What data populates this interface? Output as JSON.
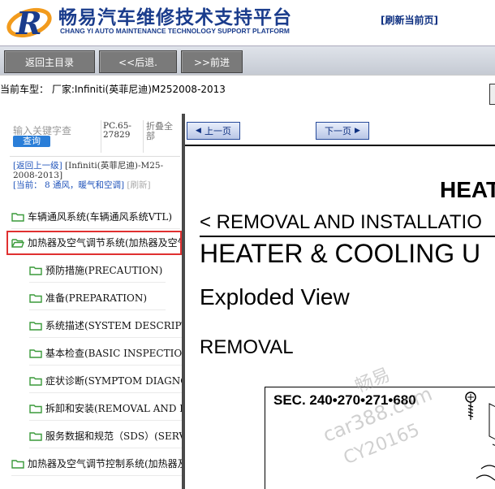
{
  "header": {
    "title": "畅易汽车维修技术支持平台",
    "subtitle": "CHANG YI AUTO MAINTENANCE TECHNOLOGY SUPPORT PLATFORM",
    "logo_icon": "chang-yi-r-logo"
  },
  "nav": {
    "main_menu": "返回主目录",
    "back": "<<后退.",
    "forward": ">>前进"
  },
  "model": {
    "text": "当前车型： 厂家:Infiniti(英菲尼迪)M252008-2013"
  },
  "sidebar": {
    "search_hint": "输入关键字查",
    "search_button": "查询",
    "pc_code": "PC.65-27829",
    "collapse_all": "折叠全部",
    "up_level": "[返回上一级]",
    "vehicle_path": "[Infiniti(英菲尼迪)-M25-2008-2013]",
    "current": "[当前：",
    "current_section": "8 通风，暖气和空调]",
    "refresh": "[刷新]",
    "items": [
      {
        "label": "车辆通风系统(车辆通风系统VTL)"
      },
      {
        "label": "加热器及空气调节系统(加热器及空气调节系统)"
      },
      {
        "label": "预防措施(PRECAUTION)"
      },
      {
        "label": "准备(PREPARATION)"
      },
      {
        "label": "系统描述(SYSTEM DESCRIPTION)"
      },
      {
        "label": "基本检查(BASIC INSPECTION)"
      },
      {
        "label": "症状诊断(SYMPTOM DIAGNOSIS)"
      },
      {
        "label": "拆卸和安装(REMOVAL AND INSTALLATION)"
      },
      {
        "label": "服务数据和规范（SDS）(SERVICE DATA)"
      },
      {
        "label": "加热器及空气调节控制系统(加热器及空气调节控制系统)"
      }
    ]
  },
  "viewer": {
    "prev_page": "上一页",
    "next_page": "下一页",
    "refresh_page": "[刷新当前页]"
  },
  "document": {
    "heat": "HEAT",
    "removal_and_installation": "< REMOVAL AND INSTALLATIO",
    "heater_cooling_unit": "HEATER & COOLING U",
    "exploded_view": "Exploded View",
    "removal": "REMOVAL",
    "sec": "SEC. 240•270•271•680"
  },
  "watermark": {
    "line1": "畅易",
    "line2": "car388.com",
    "line3": "CY20165"
  },
  "colors": {
    "brand_blue": "#1a3c8c",
    "link_blue": "#2255bb",
    "selection_red": "#e03030",
    "nav_button_gray": "#7a7a7a"
  }
}
